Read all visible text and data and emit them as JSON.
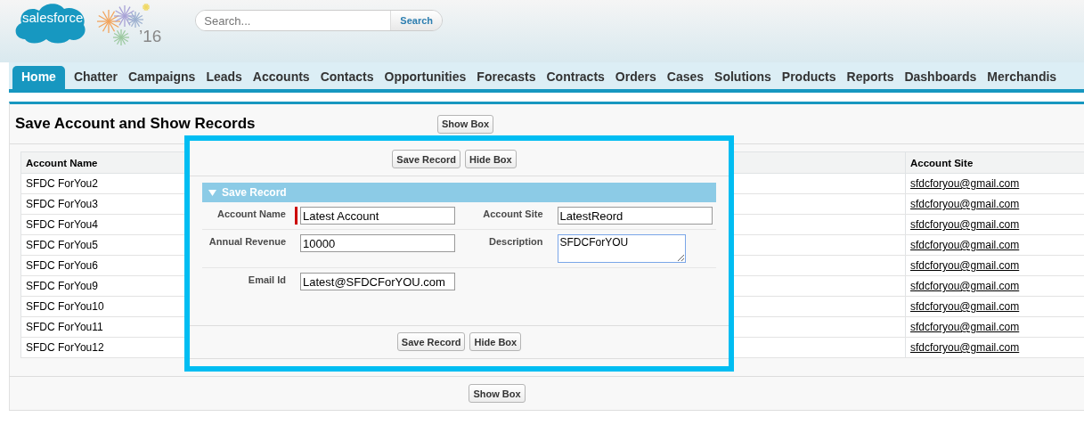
{
  "header": {
    "logo_text": "salesforce",
    "year_text": "’16",
    "search": {
      "placeholder": "Search...",
      "button": "Search"
    }
  },
  "tabs": [
    {
      "label": "Home",
      "selected": true
    },
    {
      "label": "Chatter",
      "selected": false
    },
    {
      "label": "Campaigns",
      "selected": false
    },
    {
      "label": "Leads",
      "selected": false
    },
    {
      "label": "Accounts",
      "selected": false
    },
    {
      "label": "Contacts",
      "selected": false
    },
    {
      "label": "Opportunities",
      "selected": false
    },
    {
      "label": "Forecasts",
      "selected": false
    },
    {
      "label": "Contracts",
      "selected": false
    },
    {
      "label": "Orders",
      "selected": false
    },
    {
      "label": "Cases",
      "selected": false
    },
    {
      "label": "Solutions",
      "selected": false
    },
    {
      "label": "Products",
      "selected": false
    },
    {
      "label": "Reports",
      "selected": false
    },
    {
      "label": "Dashboards",
      "selected": false
    },
    {
      "label": "Merchandis",
      "selected": false
    }
  ],
  "page": {
    "title": "Save Account and Show Records",
    "top_button": "Show Box",
    "bottom_button": "Show Box"
  },
  "table": {
    "columns": [
      "Account Name",
      "Account Site"
    ],
    "rows": [
      [
        "SFDC ForYou2",
        "sfdcforyou@gmail.com"
      ],
      [
        "SFDC ForYou3",
        "sfdcforyou@gmail.com"
      ],
      [
        "SFDC ForYou4",
        "sfdcforyou@gmail.com"
      ],
      [
        "SFDC ForYou5",
        "sfdcforyou@gmail.com"
      ],
      [
        "SFDC ForYou6",
        "sfdcforyou@gmail.com"
      ],
      [
        "SFDC ForYou9",
        "sfdcforyou@gmail.com"
      ],
      [
        "SFDC ForYou10",
        "sfdcforyou@gmail.com"
      ],
      [
        "SFDC ForYou11",
        "sfdcforyou@gmail.com"
      ],
      [
        "SFDC ForYou12",
        "sfdcforyou@gmail.com"
      ]
    ]
  },
  "modal": {
    "buttons": [
      "Save Record",
      "Hide Box"
    ],
    "section": {
      "title": "Save Record",
      "expanded": true
    },
    "rows": [
      [
        {
          "label": "Account Name",
          "value": "Latest Account",
          "kind": "input",
          "required": true
        },
        {
          "label": "Account Site",
          "value": "LatestReord",
          "kind": "input",
          "required": false
        }
      ],
      [
        {
          "label": "Annual Revenue",
          "value": "10000",
          "kind": "input",
          "required": false
        },
        {
          "label": "Description",
          "value": "SFDCForYOU",
          "kind": "textarea",
          "required": false
        }
      ],
      [
        {
          "label": "Email Id",
          "value": "Latest@SFDCForYOU.com",
          "kind": "input",
          "required": false
        }
      ]
    ],
    "bottom_buttons": [
      "Save Record",
      "Hide Box"
    ]
  }
}
